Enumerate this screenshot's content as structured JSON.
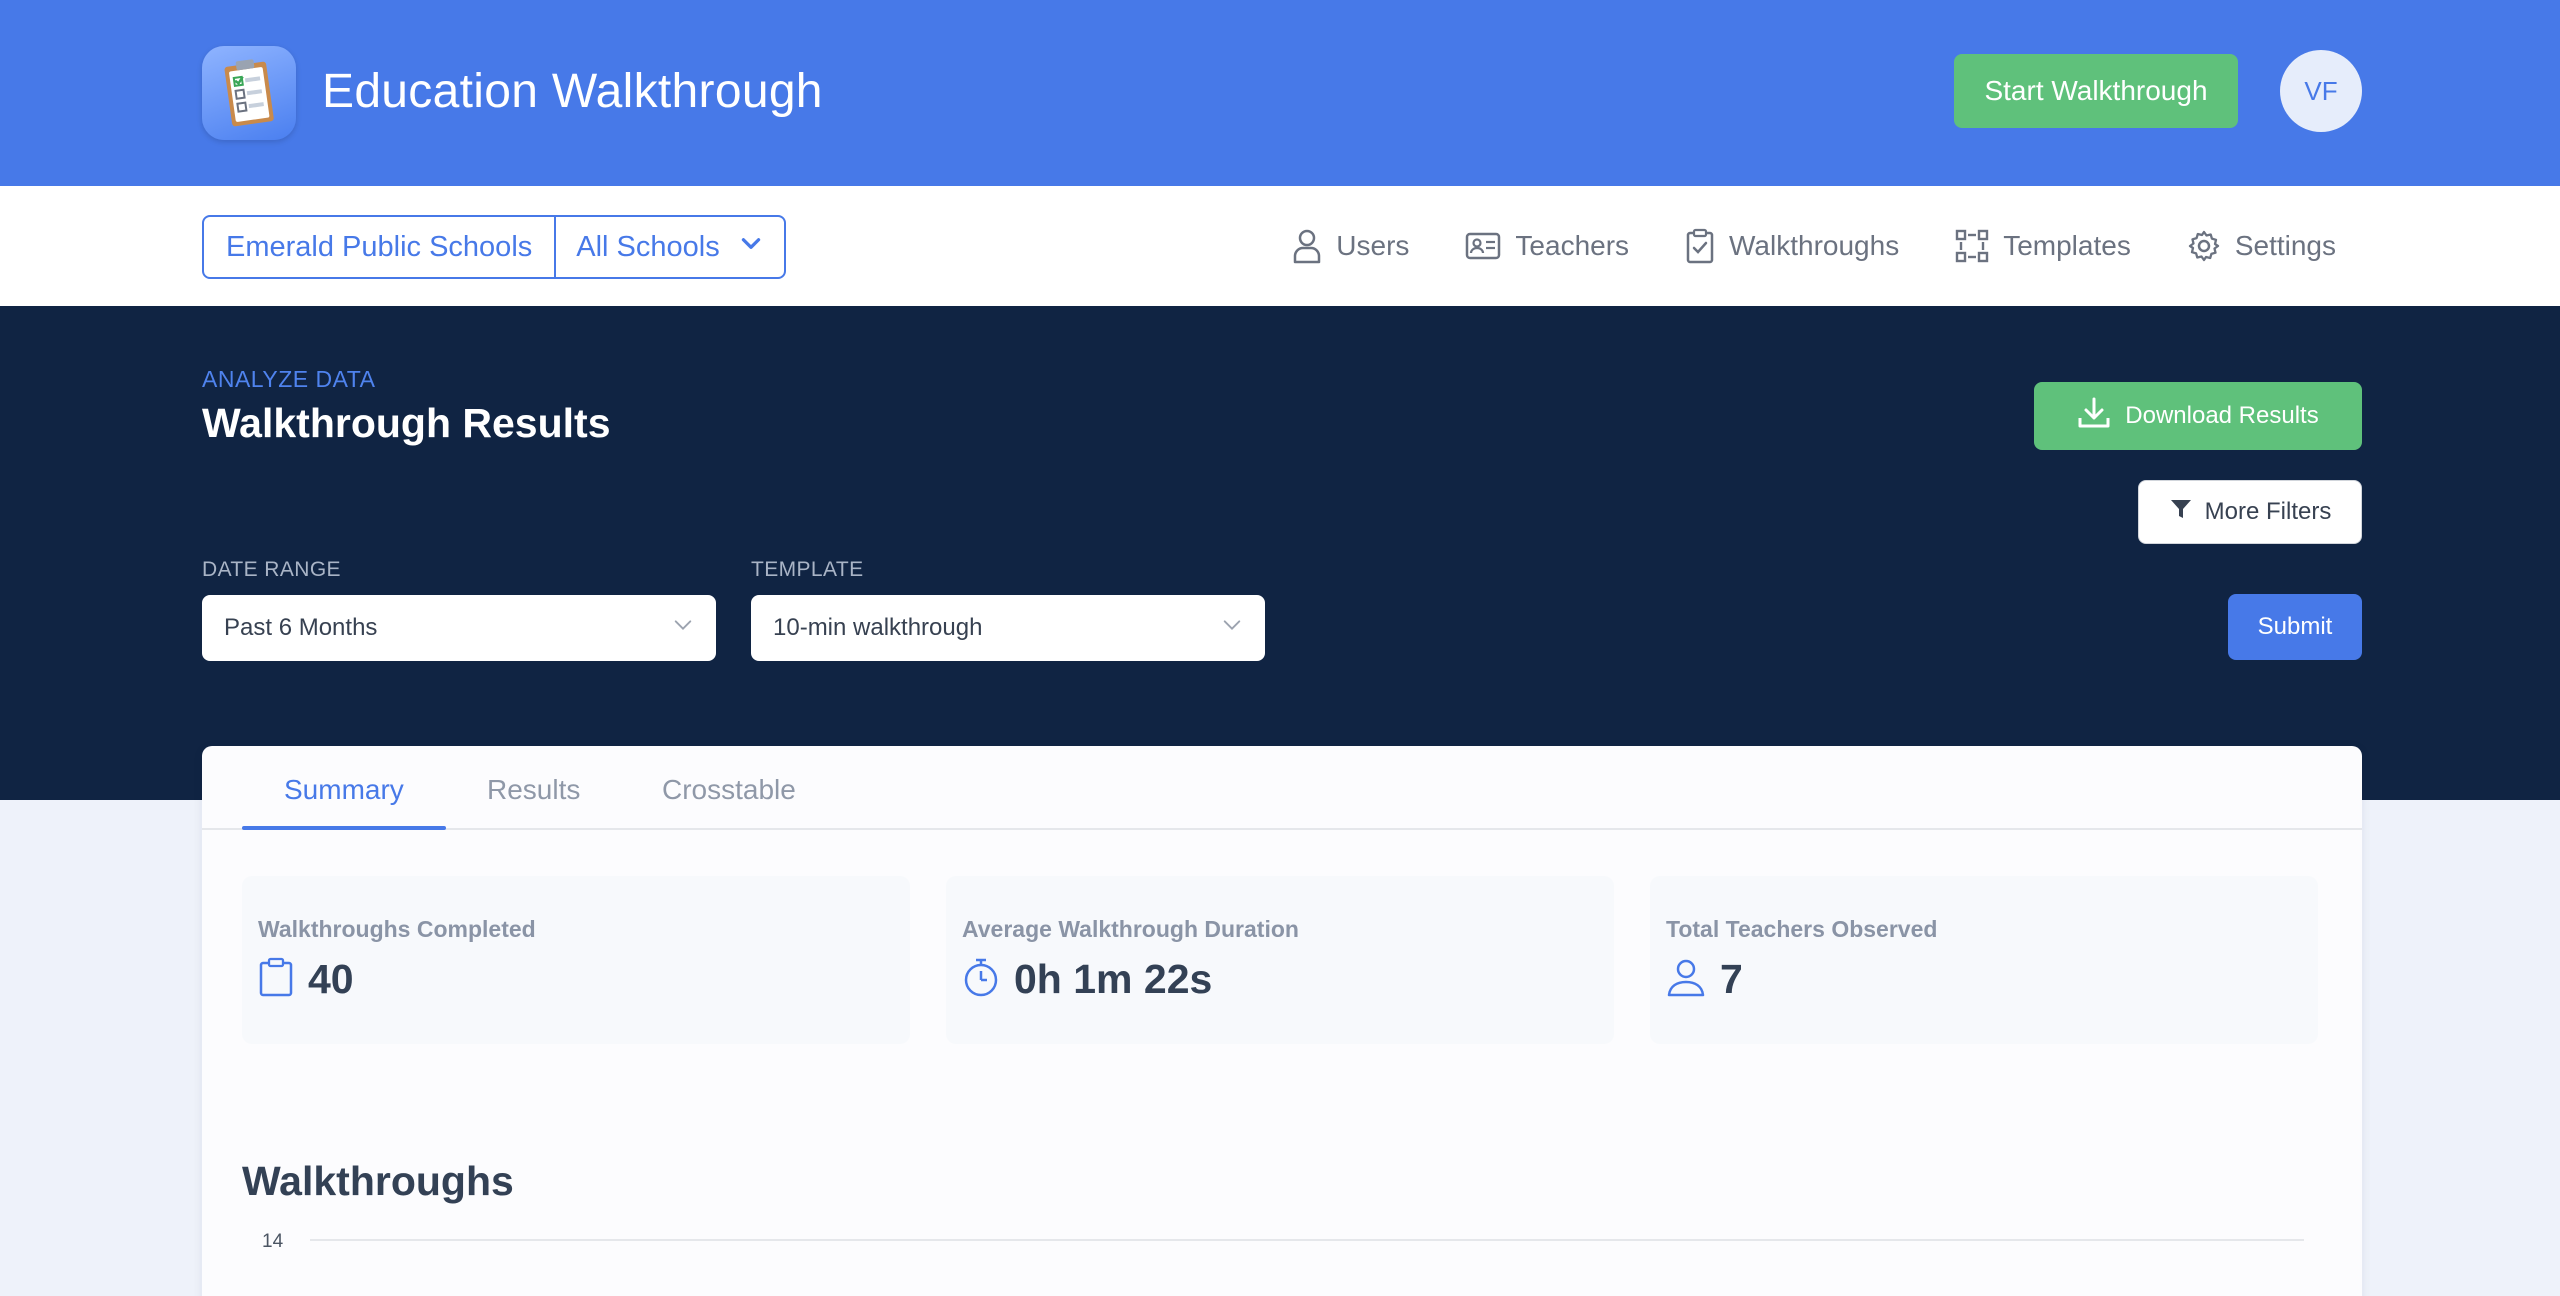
{
  "app": {
    "title": "Education Walkthrough",
    "start_label": "Start Walkthrough",
    "avatar_initials": "VF"
  },
  "nav": {
    "district": "Emerald Public Schools",
    "school": "All Schools",
    "items": [
      {
        "label": "Users",
        "icon": "user-icon"
      },
      {
        "label": "Teachers",
        "icon": "id-card-icon"
      },
      {
        "label": "Walkthroughs",
        "icon": "clipboard-check-icon"
      },
      {
        "label": "Templates",
        "icon": "templates-icon"
      },
      {
        "label": "Settings",
        "icon": "gear-icon"
      }
    ]
  },
  "hero": {
    "eyebrow": "ANALYZE DATA",
    "title": "Walkthrough Results",
    "download_label": "Download Results",
    "filters_label": "More Filters",
    "date_range_label": "DATE RANGE",
    "date_range_value": "Past 6 Months",
    "template_label": "TEMPLATE",
    "template_value": "10-min walkthrough",
    "submit_label": "Submit"
  },
  "tabs": [
    "Summary",
    "Results",
    "Crosstable"
  ],
  "active_tab": "Summary",
  "stats": [
    {
      "label": "Walkthroughs Completed",
      "value": "40",
      "icon": "clipboard-icon"
    },
    {
      "label": "Average Walkthrough Duration",
      "value": "0h 1m 22s",
      "icon": "stopwatch-icon"
    },
    {
      "label": "Total Teachers Observed",
      "value": "7",
      "icon": "user-icon"
    }
  ],
  "colors": {
    "primary": "#4779e8",
    "success": "#5fc17b",
    "navy": "#102443"
  },
  "chart_data": {
    "type": "bar",
    "title": "Walkthroughs",
    "yticks": [
      14
    ],
    "categories": [],
    "values": []
  }
}
